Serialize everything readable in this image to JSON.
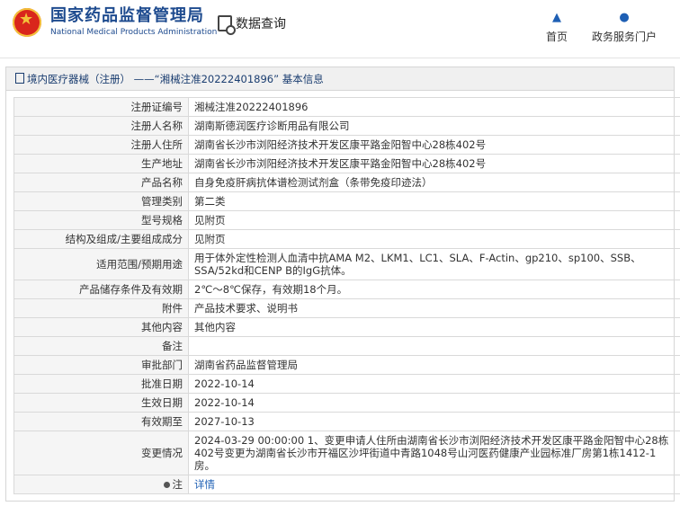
{
  "header": {
    "org_cn": "国家药品监督管理局",
    "org_en": "National Medical Products Administration",
    "query_label": "数据查询",
    "nav": [
      {
        "label": "首页",
        "icon": "home-icon"
      },
      {
        "label": "政务服务门户",
        "icon": "user-icon"
      }
    ]
  },
  "breadcrumb": "境内医疗器械（注册） ——“湘械注准20222401896” 基本信息",
  "rows": [
    {
      "key": "注册证编号",
      "value": "湘械注准20222401896"
    },
    {
      "key": "注册人名称",
      "value": "湖南斯德润医疗诊断用品有限公司"
    },
    {
      "key": "注册人住所",
      "value": "湖南省长沙市浏阳经济技术开发区康平路金阳智中心28栋402号"
    },
    {
      "key": "生产地址",
      "value": "湖南省长沙市浏阳经济技术开发区康平路金阳智中心28栋402号"
    },
    {
      "key": "产品名称",
      "value": "自身免疫肝病抗体谱检测试剂盒（条带免疫印迹法）"
    },
    {
      "key": "管理类别",
      "value": "第二类"
    },
    {
      "key": "型号规格",
      "value": "见附页"
    },
    {
      "key": "结构及组成/主要组成成分",
      "value": "见附页"
    },
    {
      "key": "适用范围/预期用途",
      "value": "用于体外定性检测人血清中抗AMA M2、LKM1、LC1、SLA、F-Actin、gp210、sp100、SSB、SSA/52kd和CENP B的IgG抗体。"
    },
    {
      "key": "产品储存条件及有效期",
      "value": "2℃～8℃保存，有效期18个月。"
    },
    {
      "key": "附件",
      "value": "产品技术要求、说明书"
    },
    {
      "key": "其他内容",
      "value": "其他内容"
    },
    {
      "key": "备注",
      "value": ""
    },
    {
      "key": "审批部门",
      "value": "湖南省药品监督管理局"
    },
    {
      "key": "批准日期",
      "value": "2022-10-14"
    },
    {
      "key": "生效日期",
      "value": "2022-10-14"
    },
    {
      "key": "有效期至",
      "value": "2027-10-13"
    },
    {
      "key": "变更情况",
      "value": "2024-03-29 00:00:00 1、变更申请人住所由湖南省长沙市浏阳经济技术开发区康平路金阳智中心28栋402号变更为湖南省长沙市开福区沙坪街道中青路1048号山河医药健康产业园标准厂房第1栋1412-1房。"
    },
    {
      "key": "注",
      "value": "详情"
    }
  ]
}
